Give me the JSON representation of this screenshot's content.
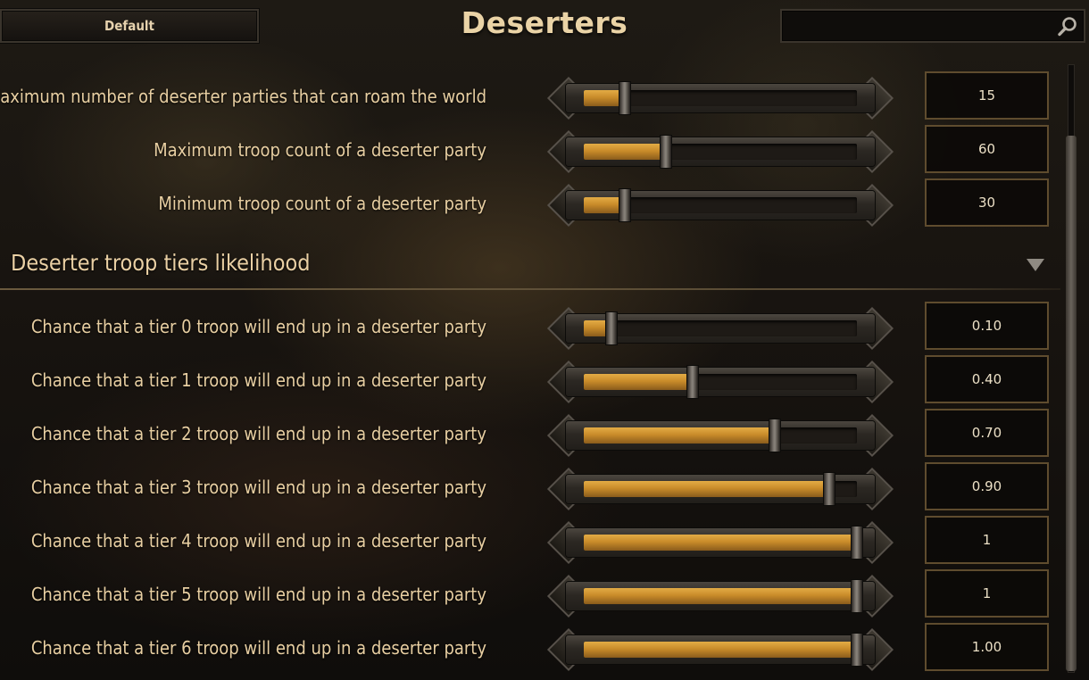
{
  "header": {
    "default_button_label": "Default",
    "title": "Deserters",
    "search_value": "",
    "search_icon": "magnifier-icon"
  },
  "rows": [
    {
      "label": "Maximum number of deserter parties that can roam the world",
      "value": "15",
      "level": 0.15
    },
    {
      "label": "Maximum troop count of a deserter party",
      "value": "60",
      "level": 0.3
    },
    {
      "label": "Minimum troop count of a deserter party",
      "value": "30",
      "level": 0.15
    }
  ],
  "tier_section": {
    "title": "Deserter troop tiers likelihood",
    "collapse_icon": "triangle-down-icon",
    "rows": [
      {
        "label": "Chance that a tier 0 troop will end up in a deserter party",
        "value": "0.10",
        "level": 0.1
      },
      {
        "label": "Chance that a tier 1 troop will end up in a deserter party",
        "value": "0.40",
        "level": 0.4
      },
      {
        "label": "Chance that a tier 2 troop will end up in a deserter party",
        "value": "0.70",
        "level": 0.7
      },
      {
        "label": "Chance that a tier 3 troop will end up in a deserter party",
        "value": "0.90",
        "level": 0.9
      },
      {
        "label": "Chance that a tier 4 troop will end up in a deserter party",
        "value": "1",
        "level": 1.0
      },
      {
        "label": "Chance that a tier 5 troop will end up in a deserter party",
        "value": "1",
        "level": 1.0
      },
      {
        "label": "Chance that a tier 6 troop will end up in a deserter party",
        "value": "1.00",
        "level": 1.0
      }
    ]
  },
  "colors": {
    "accent_gold": "#e3ac45",
    "text": "#e8cfa2",
    "value_border": "#5f4c2e"
  }
}
